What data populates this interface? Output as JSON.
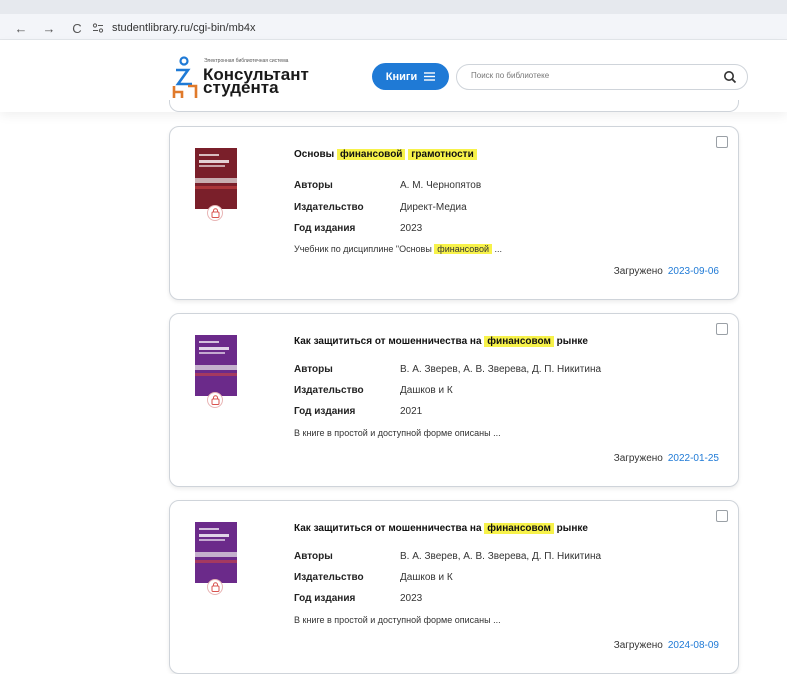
{
  "browser": {
    "url": "studentlibrary.ru/cgi-bin/mb4x",
    "back": "←",
    "forward": "→",
    "reload": "C"
  },
  "header": {
    "logo_small": "Электронная библиотечная система",
    "logo_line1": "Консультант",
    "logo_line2": "студента",
    "books_button": "Книги",
    "search_placeholder": "Поиск по библиотеке"
  },
  "labels": {
    "authors": "Авторы",
    "publisher": "Издательство",
    "year": "Год издания",
    "loaded": "Загружено"
  },
  "colors": {
    "accent": "#1f7ad6",
    "highlight": "#f7f24a"
  },
  "books": [
    {
      "title_pre": "Основы ",
      "title_hl1": "финансовой",
      "title_mid": " ",
      "title_hl2": "грамотности",
      "title_post": "",
      "authors": "А. М. Чернопятов",
      "publisher": "Директ-Медиа",
      "year": "2023",
      "desc_pre": "Учебник по дисциплине \"Основы ",
      "desc_hl": "финансовой",
      "desc_post": " ...",
      "loaded_date": "2023-09-06",
      "cover_color": "#7a1f2a"
    },
    {
      "title_pre": "Как защититься от мошенничества на ",
      "title_hl1": "финансовом",
      "title_mid": " рынке",
      "title_hl2": "",
      "title_post": "",
      "authors": "В. А. Зверев, А. В. Зверева, Д. П. Никитина",
      "publisher": "Дашков и К",
      "year": "2021",
      "desc_pre": "В книге в простой и доступной форме описаны",
      "desc_hl": "",
      "desc_post": " ...",
      "loaded_date": "2022-01-25",
      "cover_color": "#6b2a8a"
    },
    {
      "title_pre": "Как защититься от мошенничества на ",
      "title_hl1": "финансовом",
      "title_mid": " рынке",
      "title_hl2": "",
      "title_post": "",
      "authors": "В. А. Зверев, А. В. Зверева, Д. П. Никитина",
      "publisher": "Дашков и К",
      "year": "2023",
      "desc_pre": "В книге в простой и доступной форме описаны",
      "desc_hl": "",
      "desc_post": " ...",
      "loaded_date": "2024-08-09",
      "cover_color": "#6b2a8a"
    }
  ]
}
